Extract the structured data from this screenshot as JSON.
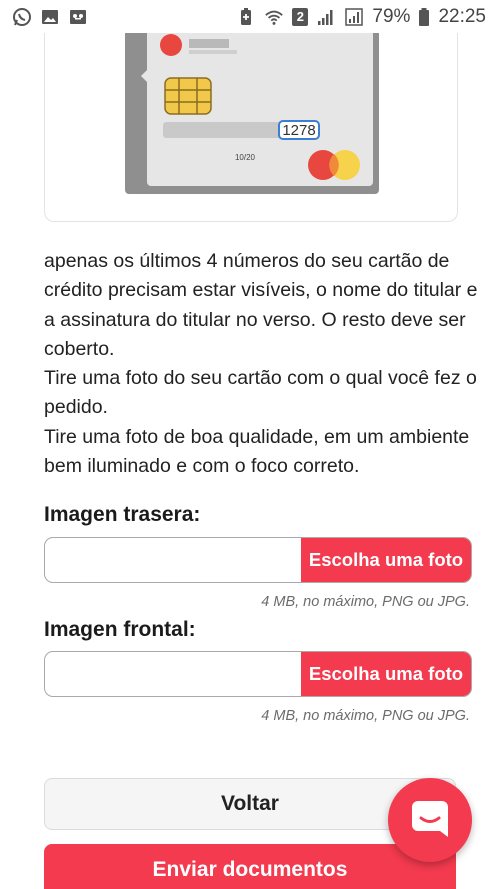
{
  "status_bar": {
    "left_icons": [
      "whatsapp-icon",
      "gallery-icon",
      "voicemail-icon"
    ],
    "right_icons": [
      "battery-saver-icon",
      "wifi-icon",
      "sim-icon",
      "signal-icon",
      "signal-icon",
      "battery-icon"
    ],
    "sim_number": "2",
    "battery": "79%",
    "time": "22:25"
  },
  "card_illustration": {
    "highlighted_digits": "1278",
    "expiry": "10/20"
  },
  "instructions": [
    "apenas os últimos 4 números do seu cartão de crédito precisam estar visíveis, o nome do titular e a assinatura do titular no verso. O resto deve ser coberto.",
    "Tire uma foto do seu cartão com o qual você fez o pedido.",
    "Tire uma foto de boa qualidade, em um ambiente bem iluminado e com o foco correto."
  ],
  "uploads": [
    {
      "label": "Imagen trasera:",
      "button": "Escolha uma foto",
      "hint": "4 MB, no máximo, PNG ou JPG."
    },
    {
      "label": "Imagen frontal:",
      "button": "Escolha uma foto",
      "hint": "4 MB, no máximo, PNG ou JPG."
    }
  ],
  "actions": {
    "back": "Voltar",
    "submit": "Enviar documentos"
  },
  "colors": {
    "accent": "#f33a4e",
    "card_gray": "#8f8f8f",
    "chip_gold": "#f2c84b",
    "mastercard_red": "#e8473f",
    "mastercard_yellow": "#f6d34a"
  },
  "chat_widget_icon": "chat-bubble-icon"
}
